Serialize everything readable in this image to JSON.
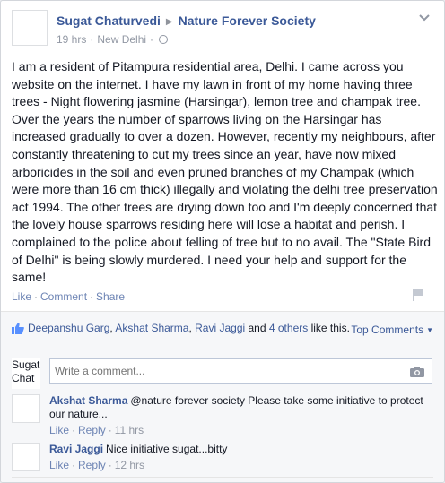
{
  "post": {
    "author": "Sugat Chaturvedi",
    "target": "Nature Forever Society",
    "time": "19 hrs",
    "location": "New Delhi",
    "body": "I am a resident of Pitampura residential area, Delhi. I came across you website on the internet. I have my lawn in front of my home having three trees - Night flowering jasmine (Harsingar), lemon tree and champak tree. Over the years the number of sparrows living on the Harsingar has increased gradually to over a dozen. However, recently my neighbours, after constantly threatening to cut my trees since an year, have now mixed arboricides in the soil and even pruned branches of my Champak (which were more than 16 cm thick) illegally and violating the delhi tree preservation act 1994. The other trees are drying down too and I'm deeply concerned that the lovely house sparrows residing here will lose a habitat and perish. I complained to the police about felling of tree but to no avail. The \"State Bird of Delhi\" is being slowly murdered. I need your help and support for the same!",
    "actions": {
      "like": "Like",
      "comment": "Comment",
      "share": "Share"
    }
  },
  "likes": {
    "names": [
      "Deepanshu Garg",
      "Akshat Sharma",
      "Ravi Jaggi"
    ],
    "sep1": ", ",
    "sep2": ", ",
    "and": " and ",
    "others": "4 others",
    "suffix": " like this."
  },
  "top_comments_label": "Top Comments",
  "composer": {
    "avatar_text": "Sugat Chat",
    "placeholder": "Write a comment..."
  },
  "comments": [
    {
      "author": "Akshat Sharma",
      "text": "@nature forever society Please take some initiative to protect our nature...",
      "like": "Like",
      "reply": "Reply",
      "time": "11 hrs"
    },
    {
      "author": "Ravi Jaggi",
      "text": "Nice initiative sugat...bitty",
      "like": "Like",
      "reply": "Reply",
      "time": "12 hrs"
    }
  ],
  "icons": {
    "chevron": "chevron-down-icon",
    "globe": "globe-icon",
    "flag": "flag-icon",
    "thumb": "thumbs-up-icon",
    "camera": "camera-icon"
  },
  "colors": {
    "link": "#3b5998",
    "muted": "#9197a3",
    "action": "#6d84b4"
  }
}
